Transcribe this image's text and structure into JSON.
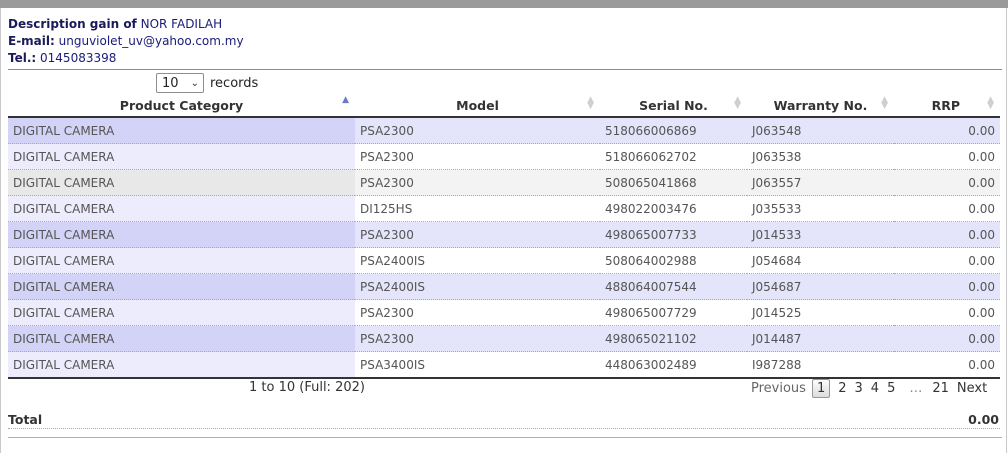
{
  "customer": {
    "desc_label": "Description gain of",
    "name": "NOR FADILAH",
    "email_label": "E-mail:",
    "email": "unguviolet_uv@yahoo.com.my",
    "tel_label": "Tel.:",
    "tel": "0145083398"
  },
  "records": {
    "page_size": "10",
    "label": "records"
  },
  "table": {
    "columns": [
      "Product Category",
      "Model",
      "Serial No.",
      "Warranty No.",
      "RRP"
    ],
    "sorted_column": "Product Category",
    "sort_direction": "ascending",
    "rows": [
      [
        "DIGITAL CAMERA",
        "PSA2300",
        "518066006869",
        "J063548",
        "0.00"
      ],
      [
        "DIGITAL CAMERA",
        "PSA2300",
        "518066062702",
        "J063538",
        "0.00"
      ],
      [
        "DIGITAL CAMERA",
        "PSA2300",
        "508065041868",
        "J063557",
        "0.00"
      ],
      [
        "DIGITAL CAMERA",
        "DI125HS",
        "498022003476",
        "J035533",
        "0.00"
      ],
      [
        "DIGITAL CAMERA",
        "PSA2300",
        "498065007733",
        "J014533",
        "0.00"
      ],
      [
        "DIGITAL CAMERA",
        "PSA2400IS",
        "508064002988",
        "J054684",
        "0.00"
      ],
      [
        "DIGITAL CAMERA",
        "PSA2400IS",
        "488064007544",
        "J054687",
        "0.00"
      ],
      [
        "DIGITAL CAMERA",
        "PSA2300",
        "498065007729",
        "J014525",
        "0.00"
      ],
      [
        "DIGITAL CAMERA",
        "PSA2300",
        "498065021102",
        "J014487",
        "0.00"
      ],
      [
        "DIGITAL CAMERA",
        "PSA3400IS",
        "448063002489",
        "I987288",
        "0.00"
      ]
    ]
  },
  "pagination": {
    "info": "1 to 10 (Full: 202)",
    "previous": "Previous",
    "pages": [
      "1",
      "2",
      "3",
      "4",
      "5"
    ],
    "current": "1",
    "ellipsis": "…",
    "last": "21",
    "next": "Next"
  },
  "total": {
    "label": "Total",
    "value": "0.00"
  }
}
